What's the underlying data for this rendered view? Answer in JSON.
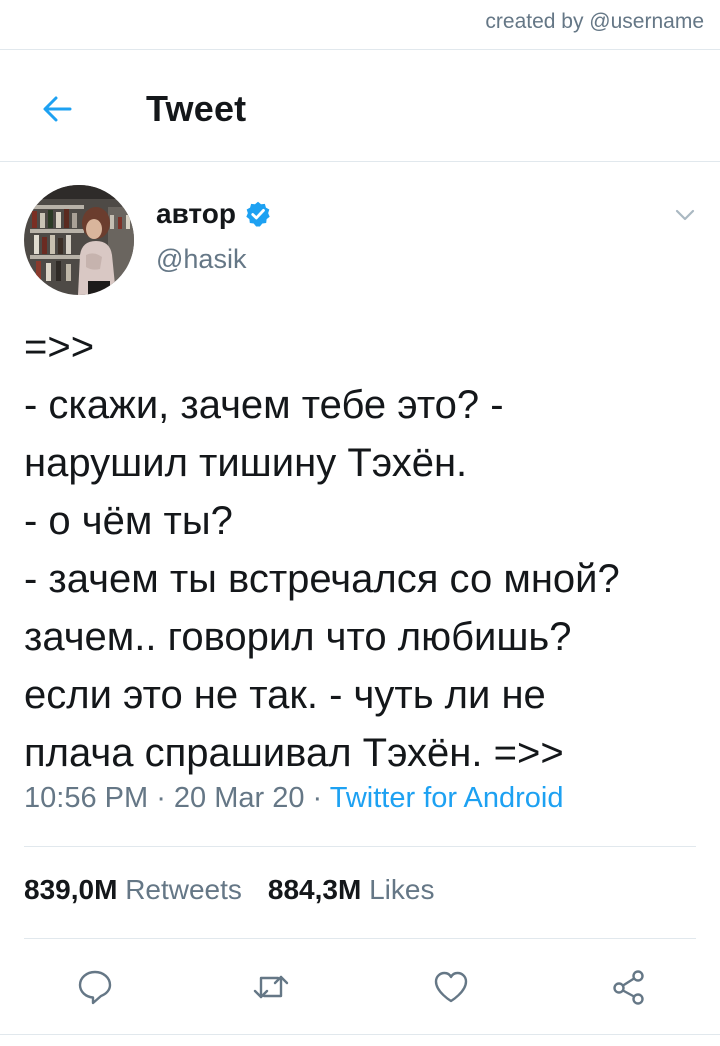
{
  "watermark": "created by @username",
  "header": {
    "title": "Tweet"
  },
  "author": {
    "name": "автор",
    "handle": "@hasik"
  },
  "tweet": {
    "text": "=>>\n- скажи, зачем тебе это? -\nнарушил тишину Тэхён.\n- о чём ты?\n- зачем ты встречался со мной?\nзачем.. говорил что любишь?\nесли это не так. - чуть ли не\nплача спрашивал Тэхён. =>>",
    "time": "10:56 PM",
    "separator": " · ",
    "date": "20 Mar 20",
    "source": "Twitter for Android"
  },
  "stats": {
    "retweets_count": "839,0M",
    "retweets_label": "Retweets",
    "likes_count": "884,3M",
    "likes_label": "Likes"
  },
  "icons": {
    "back": "arrow-left-icon",
    "verified": "verified-badge-icon",
    "caret": "chevron-down-icon",
    "reply": "reply-icon",
    "retweet": "retweet-icon",
    "like": "heart-icon",
    "share": "share-icon"
  },
  "colors": {
    "accent": "#1da1f2",
    "text": "#14171a",
    "secondary": "#657786",
    "divider": "#e1e8ed"
  }
}
